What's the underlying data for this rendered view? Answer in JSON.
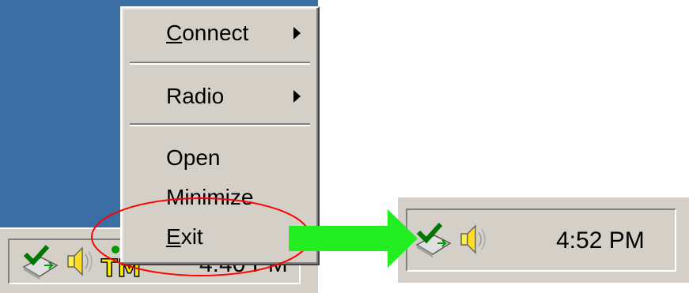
{
  "context_menu": {
    "items": [
      {
        "label": "Connect",
        "has_submenu": true,
        "underlined_char": "C"
      },
      {
        "label": "Radio",
        "has_submenu": true
      },
      {
        "label": "Open",
        "has_submenu": false
      },
      {
        "label": "Minimize",
        "has_submenu": false
      },
      {
        "label": "Exit",
        "has_submenu": false,
        "underlined_char": "E"
      }
    ]
  },
  "tray_before": {
    "clock": "4:40 PM",
    "icons": [
      "network-connection-icon",
      "volume-speaker-icon",
      "tm-app-icon"
    ]
  },
  "tray_after": {
    "clock": "4:52 PM",
    "icons": [
      "network-connection-icon",
      "volume-speaker-icon"
    ]
  },
  "annotations": {
    "highlight_color": "#ff0000",
    "arrow_color": "#22ee22"
  },
  "colors": {
    "desktop": "#3a6ea5",
    "taskbar": "#d4d0c8"
  }
}
